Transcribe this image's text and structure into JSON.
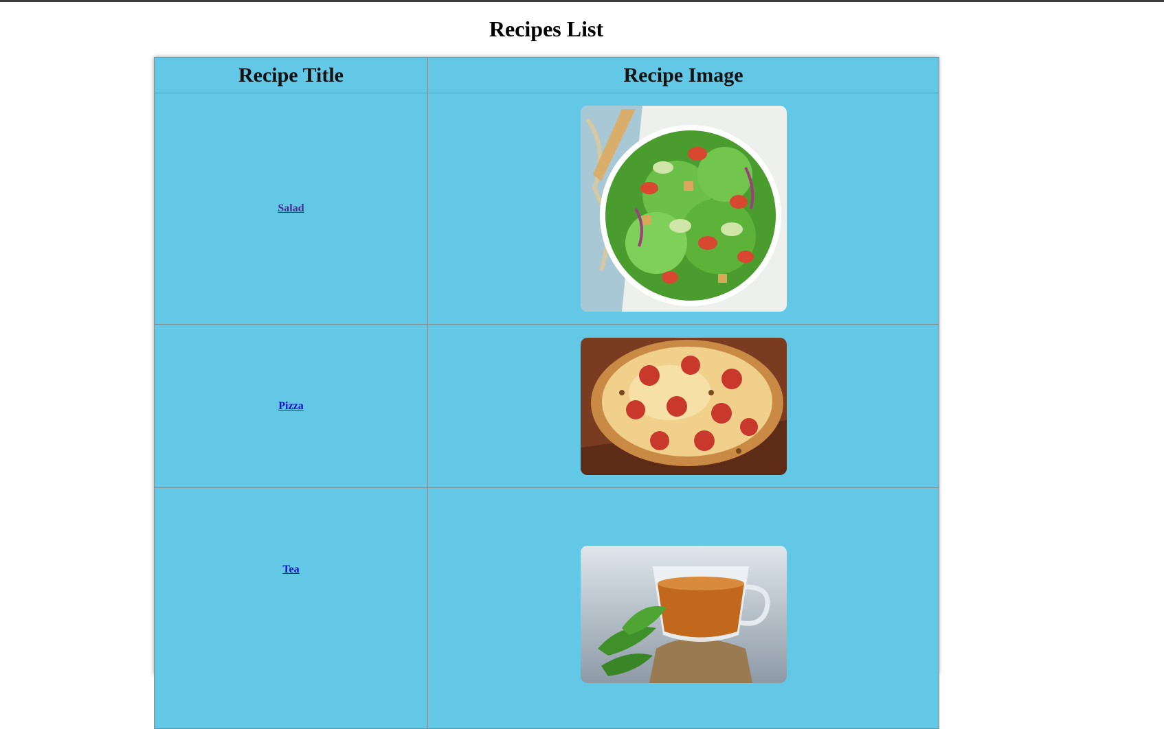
{
  "page": {
    "title": "Recipes List"
  },
  "table": {
    "headers": [
      "Recipe Title",
      "Recipe Image"
    ],
    "rows": [
      {
        "title": "Salad",
        "image": "salad-image",
        "visited": true
      },
      {
        "title": "Pizza",
        "image": "pizza-image",
        "visited": false
      },
      {
        "title": "Tea",
        "image": "tea-image",
        "visited": false
      }
    ]
  },
  "colors": {
    "table_bg": "#63c7e6",
    "border": "#7f8f95",
    "link_visited": "#4b2b8a",
    "link": "#1a0dd6"
  }
}
